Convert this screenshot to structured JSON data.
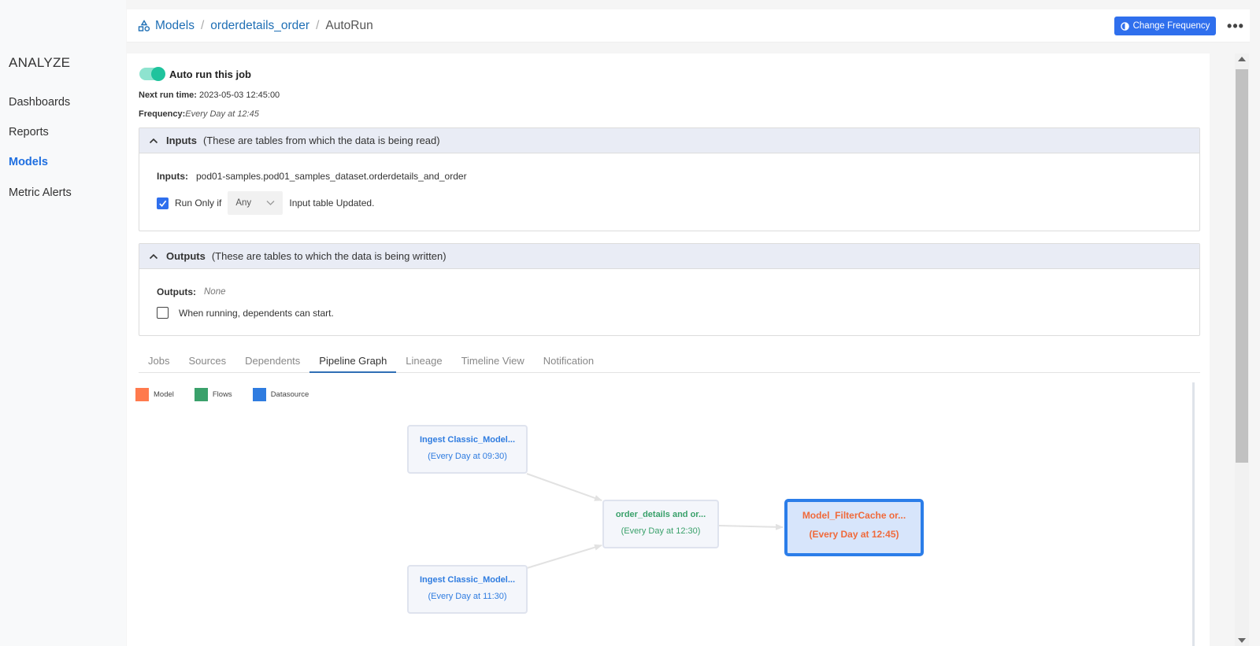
{
  "sidebar": {
    "section_title": "ANALYZE",
    "items": [
      {
        "label": "Dashboards"
      },
      {
        "label": "Reports"
      },
      {
        "label": "Models"
      },
      {
        "label": "Metric Alerts"
      }
    ]
  },
  "header": {
    "breadcrumb": [
      "Models",
      "orderdetails_order",
      "AutoRun"
    ],
    "change_frequency_label": "Change Frequency",
    "more_label": "•••"
  },
  "job": {
    "auto_run_label": "Auto run this job",
    "next_run_label": "Next run time:",
    "next_run_value": "2023-05-03 12:45:00",
    "frequency_label": "Frequency:",
    "frequency_value": "Every Day at 12:45"
  },
  "inputs": {
    "title": "Inputs",
    "subtitle": "(These are tables from which the data is being read)",
    "field_label": "Inputs:",
    "field_value": "pod01-samples.pod01_samples_dataset.orderdetails_and_order",
    "run_only_if_label": "Run Only if",
    "run_only_if_checked": true,
    "select_value": "Any",
    "trailing_text": "Input table Updated."
  },
  "outputs": {
    "title": "Outputs",
    "subtitle": "(These are tables to which the data is being written)",
    "field_label": "Outputs:",
    "field_value": "None",
    "dependents_label": "When running, dependents can start.",
    "dependents_checked": false
  },
  "tabs": [
    {
      "label": "Jobs",
      "active": false
    },
    {
      "label": "Sources",
      "active": false
    },
    {
      "label": "Dependents",
      "active": false
    },
    {
      "label": "Pipeline Graph",
      "active": true
    },
    {
      "label": "Lineage",
      "active": false
    },
    {
      "label": "Timeline View",
      "active": false
    },
    {
      "label": "Notification",
      "active": false
    }
  ],
  "legend": [
    {
      "label": "Model",
      "color": "#ff7a4d"
    },
    {
      "label": "Flows",
      "color": "#3aa16b"
    },
    {
      "label": "Datasource",
      "color": "#2f7ce0"
    }
  ],
  "graph": {
    "nodes": [
      {
        "id": "ds1",
        "title": "Ingest Classic_Model...",
        "subtitle": "(Every Day at 09:30)",
        "kind": "Datasource"
      },
      {
        "id": "ds2",
        "title": "Ingest Classic_Model...",
        "subtitle": "(Every Day at 11:30)",
        "kind": "Datasource"
      },
      {
        "id": "flow1",
        "title": "order_details and or...",
        "subtitle": "(Every Day at 12:30)",
        "kind": "Flows"
      },
      {
        "id": "model1",
        "title": "Model_FilterCache or...",
        "subtitle": "(Every Day at 12:45)",
        "kind": "Model"
      }
    ],
    "edges": [
      {
        "from": "ds1",
        "to": "flow1"
      },
      {
        "from": "ds2",
        "to": "flow1"
      },
      {
        "from": "flow1",
        "to": "model1"
      }
    ]
  }
}
